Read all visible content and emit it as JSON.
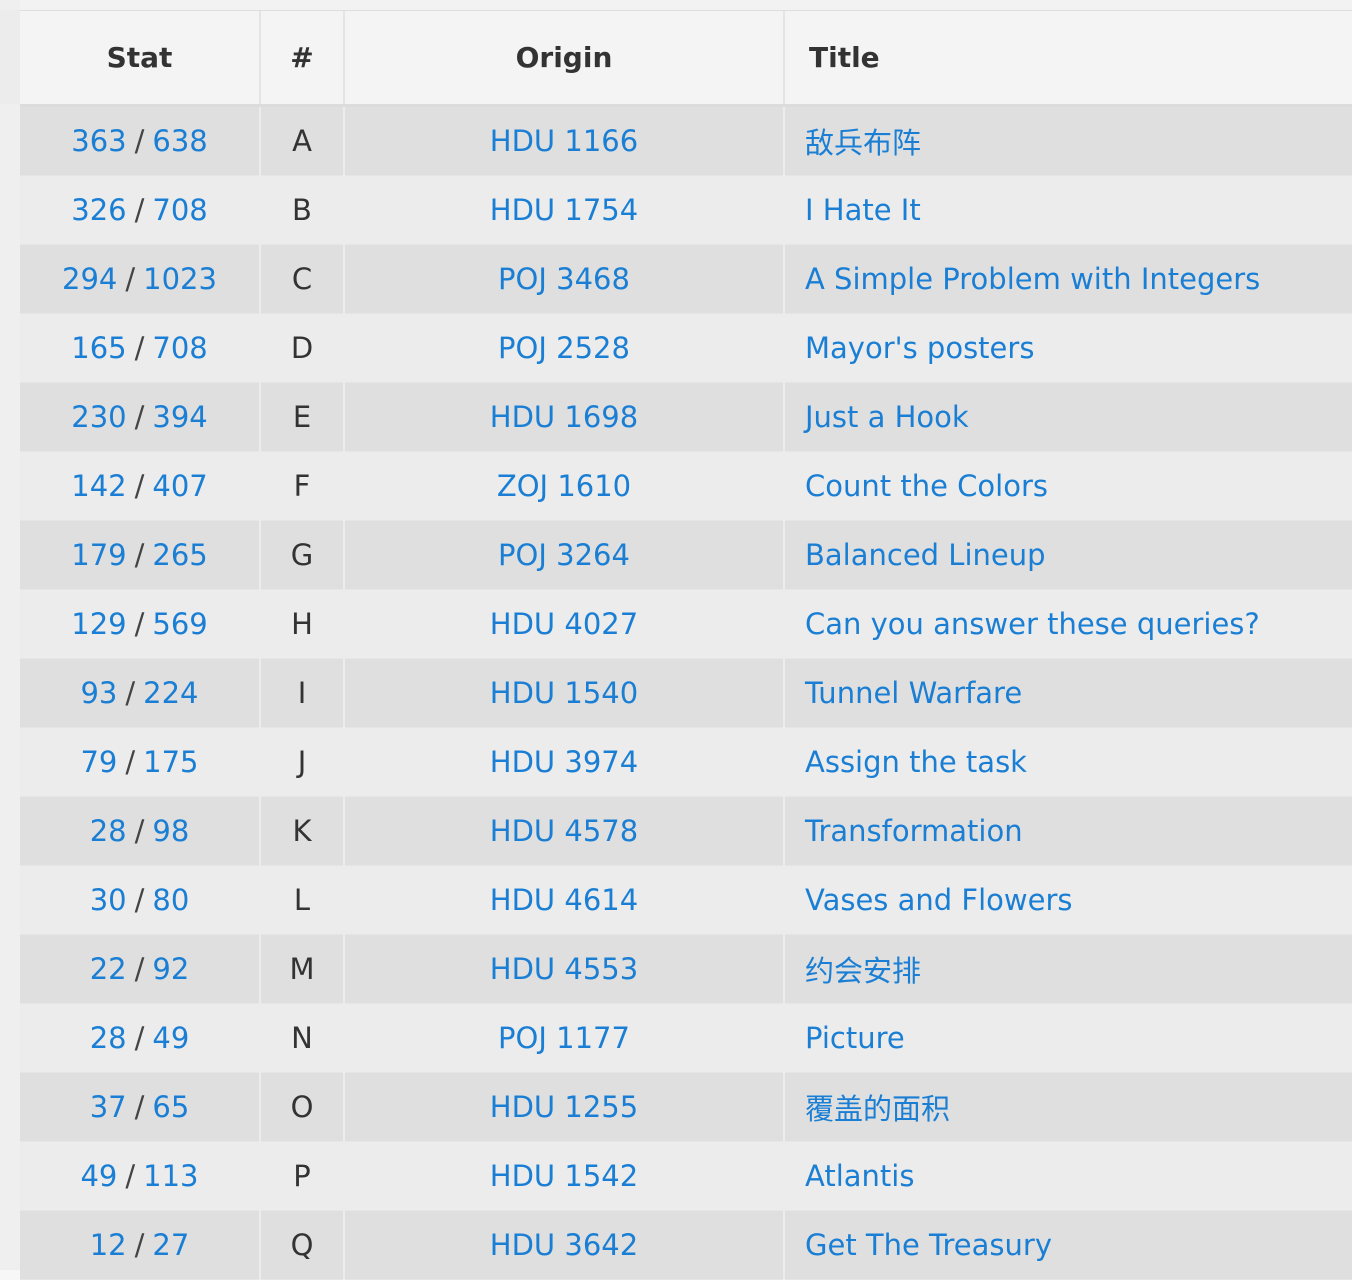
{
  "headers": {
    "stat": "Stat",
    "num": "#",
    "origin": "Origin",
    "title": "Title"
  },
  "rows": [
    {
      "solved": "363",
      "attempts": "638",
      "num": "A",
      "origin": "HDU 1166",
      "title": "敌兵布阵"
    },
    {
      "solved": "326",
      "attempts": "708",
      "num": "B",
      "origin": "HDU 1754",
      "title": "I Hate It"
    },
    {
      "solved": "294",
      "attempts": "1023",
      "num": "C",
      "origin": "POJ 3468",
      "title": "A Simple Problem with Integers"
    },
    {
      "solved": "165",
      "attempts": "708",
      "num": "D",
      "origin": "POJ 2528",
      "title": "Mayor's posters"
    },
    {
      "solved": "230",
      "attempts": "394",
      "num": "E",
      "origin": "HDU 1698",
      "title": "Just a Hook"
    },
    {
      "solved": "142",
      "attempts": "407",
      "num": "F",
      "origin": "ZOJ 1610",
      "title": "Count the Colors"
    },
    {
      "solved": "179",
      "attempts": "265",
      "num": "G",
      "origin": "POJ 3264",
      "title": "Balanced Lineup"
    },
    {
      "solved": "129",
      "attempts": "569",
      "num": "H",
      "origin": "HDU 4027",
      "title": "Can you answer these queries?"
    },
    {
      "solved": "93",
      "attempts": "224",
      "num": "I",
      "origin": "HDU 1540",
      "title": "Tunnel Warfare"
    },
    {
      "solved": "79",
      "attempts": "175",
      "num": "J",
      "origin": "HDU 3974",
      "title": "Assign the task"
    },
    {
      "solved": "28",
      "attempts": "98",
      "num": "K",
      "origin": "HDU 4578",
      "title": "Transformation"
    },
    {
      "solved": "30",
      "attempts": "80",
      "num": "L",
      "origin": "HDU 4614",
      "title": "Vases and Flowers"
    },
    {
      "solved": "22",
      "attempts": "92",
      "num": "M",
      "origin": "HDU 4553",
      "title": "约会安排"
    },
    {
      "solved": "28",
      "attempts": "49",
      "num": "N",
      "origin": "POJ 1177",
      "title": "Picture"
    },
    {
      "solved": "37",
      "attempts": "65",
      "num": "O",
      "origin": "HDU 1255",
      "title": "覆盖的面积"
    },
    {
      "solved": "49",
      "attempts": "113",
      "num": "P",
      "origin": "HDU 1542",
      "title": "Atlantis"
    },
    {
      "solved": "12",
      "attempts": "27",
      "num": "Q",
      "origin": "HDU 3642",
      "title": "Get The Treasury"
    }
  ],
  "separator": "/",
  "colors": {
    "link": "#1a7fd4",
    "row_odd": "#dfdfdf",
    "row_even": "#ececec",
    "header_bg": "#f4f4f4"
  }
}
